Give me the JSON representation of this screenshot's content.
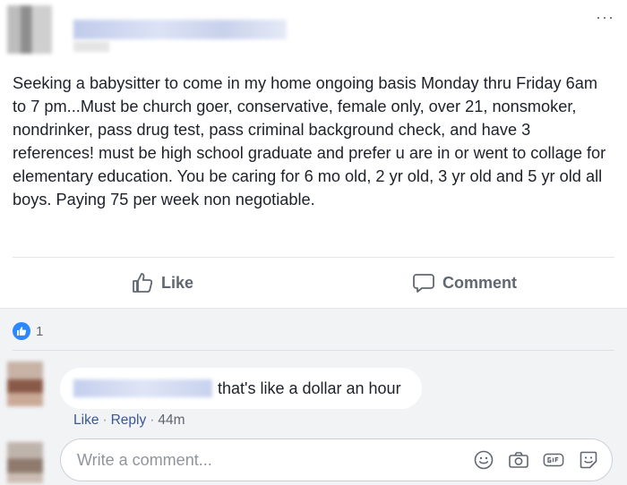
{
  "post": {
    "more_label": "···",
    "text": "Seeking a babysitter to come in my home ongoing basis Monday thru Friday 6am to 7 pm...Must be church goer, conservative, female only, over 21, nonsmoker, nondrinker, pass drug test, pass criminal background check, and have 3 references! must be high school graduate and prefer u are in or went to collage for elementary education. You be caring for 6 mo old, 2 yr old, 3 yr old and 5 yr old all boys. Paying 75 per week non negotiable."
  },
  "actions": {
    "like_label": "Like",
    "comment_label": "Comment"
  },
  "reactions": {
    "count": "1"
  },
  "comment": {
    "text": "that's like a dollar an hour",
    "like_label": "Like",
    "reply_label": "Reply",
    "separator": "·",
    "time": "44m"
  },
  "composer": {
    "placeholder": "Write a comment..."
  },
  "icons": [
    "like-thumb-icon",
    "comment-bubble-icon",
    "reaction-like-icon",
    "emoji-icon",
    "camera-icon",
    "gif-icon",
    "sticker-icon"
  ],
  "colors": {
    "link": "#385898",
    "reaction_blue": "#2d88ff",
    "muted": "#606770"
  }
}
